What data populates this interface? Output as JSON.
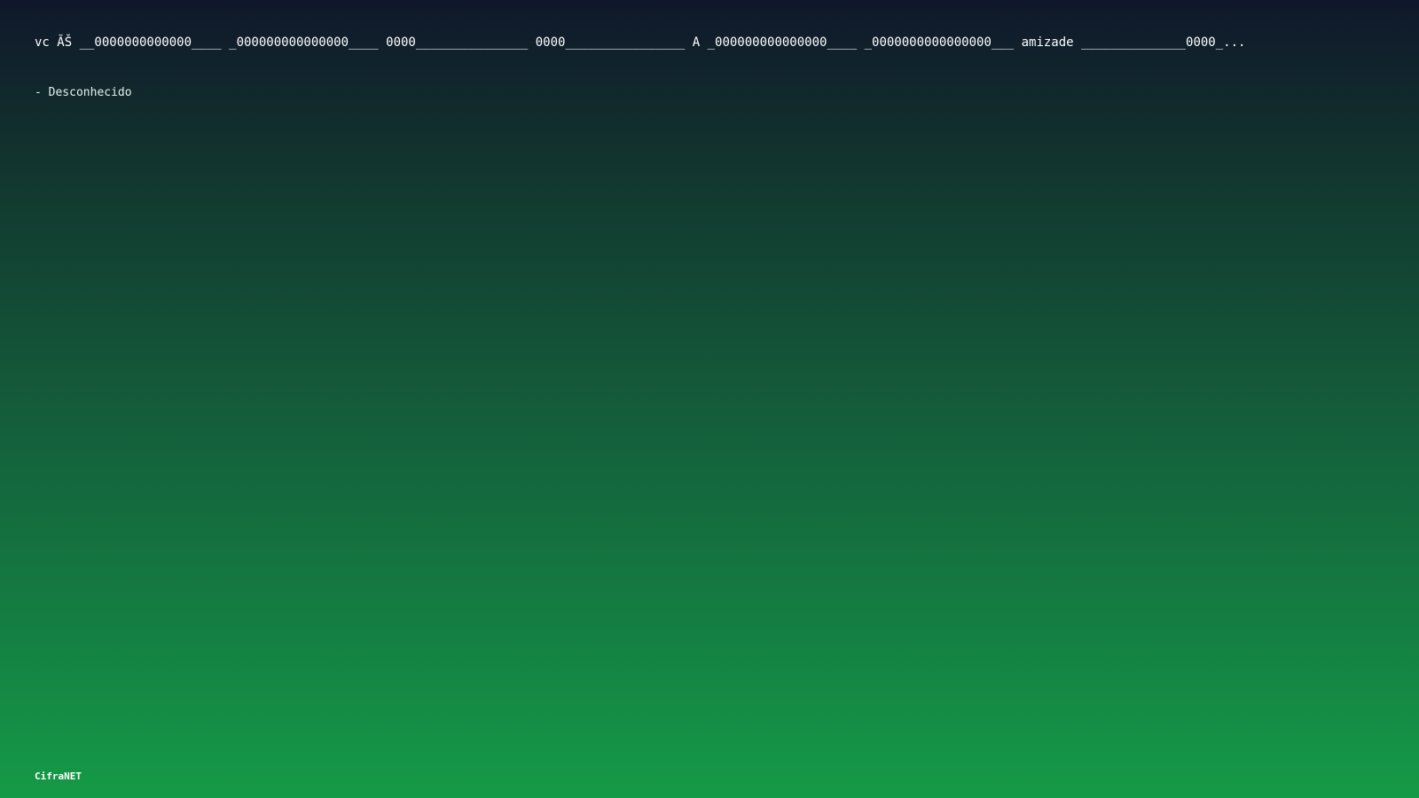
{
  "quote": {
    "text": "vc ĂŠ __0000000000000____ _000000000000000____ 0000_______________ 0000________________ A _000000000000000____ _0000000000000000___ amizade ______________0000_...",
    "author": "- Desconhecido"
  },
  "brand": {
    "name": "CifraNET"
  },
  "theme": {
    "gradient_top": "#0f172a",
    "gradient_bottom": "#159a47",
    "text_color": "#ffffff"
  }
}
